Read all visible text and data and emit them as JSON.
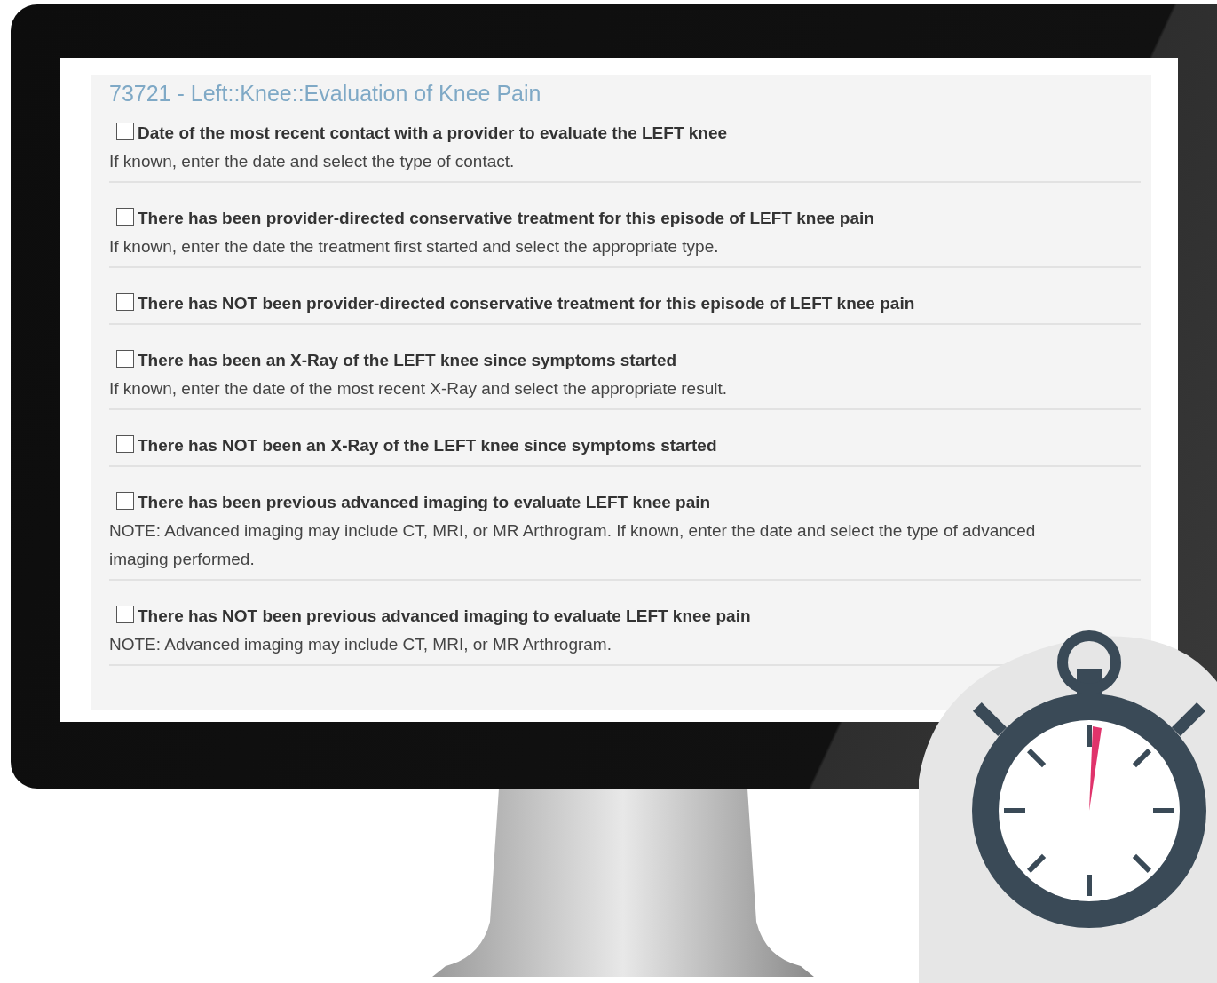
{
  "form": {
    "title": "73721 - Left::Knee::Evaluation of Knee Pain",
    "items": [
      {
        "label": "Date of the most recent contact with a provider to evaluate the LEFT knee",
        "note": "If known, enter the date and select the type of contact.",
        "checked": false
      },
      {
        "label": "There has been provider-directed conservative treatment for this episode of LEFT knee pain",
        "note": "If known, enter the date the treatment first started and select the appropriate type.",
        "checked": false
      },
      {
        "label": "There has NOT been provider-directed conservative treatment for this episode of LEFT knee pain",
        "checked": false
      },
      {
        "label": "There has been an X-Ray of the LEFT knee since symptoms started",
        "note": "If known, enter the date of the most recent X-Ray and select the appropriate result.",
        "checked": false
      },
      {
        "label": "There has NOT been an X-Ray of the LEFT knee since symptoms started",
        "checked": false
      },
      {
        "label": "There has been previous advanced imaging to evaluate LEFT knee pain",
        "note": "NOTE: Advanced imaging may include CT, MRI, or MR Arthrogram. If known, enter the date and select the type of advanced imaging performed.",
        "checked": false
      },
      {
        "label": "There has NOT been previous advanced imaging to evaluate LEFT knee pain",
        "note": "NOTE: Advanced imaging may include CT, MRI, or MR Arthrogram.",
        "checked": false
      }
    ]
  }
}
